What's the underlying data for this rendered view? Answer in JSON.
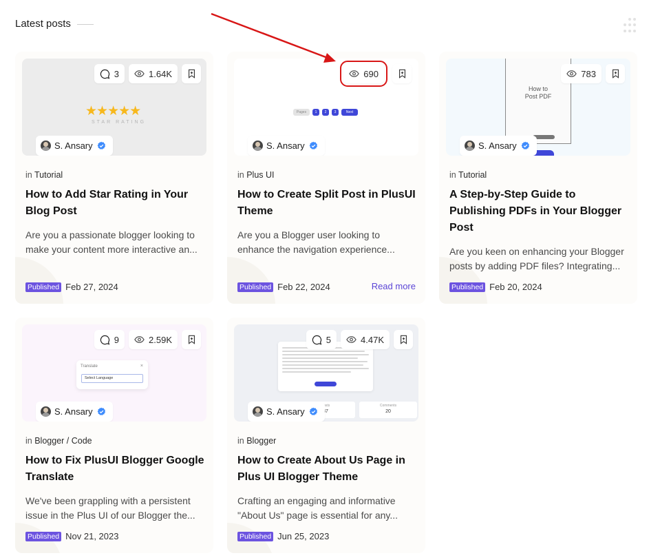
{
  "section": {
    "title": "Latest posts"
  },
  "posts": [
    {
      "comments": "3",
      "views": "1.64K",
      "author": "S. Ansary",
      "category_prefix": "in",
      "category": "Tutorial",
      "title": "How to Add Star Rating in Your Blog Post",
      "excerpt": "Are you a passionate blogger looking to make your content more interactive an...",
      "status": "Published",
      "date": "Feb 27, 2024",
      "thumb": {
        "stars": "★★★★★",
        "caption": "STAR RATING"
      }
    },
    {
      "views": "690",
      "author": "S. Ansary",
      "category_prefix": "in",
      "category": "Plus UI",
      "title": "How to Create Split Post in PlusUI Theme",
      "excerpt": "Are you a Blogger user looking to enhance the navigation experience...",
      "status": "Published",
      "date": "Feb 22, 2024",
      "read_more": "Read more",
      "thumb": {
        "prev": "Pages",
        "p1": "1",
        "p2": "2",
        "p3": "3",
        "next": "Next"
      }
    },
    {
      "views": "783",
      "author": "S. Ansary",
      "category_prefix": "in",
      "category": "Tutorial",
      "title": "A Step-by-Step Guide to Publishing PDFs in Your Blogger Post",
      "excerpt": "Are you keen on enhancing your Blogger posts by adding PDF files? Integrating...",
      "status": "Published",
      "date": "Feb 20, 2024",
      "thumb": {
        "line1": "How to",
        "line2": "Post PDF"
      }
    },
    {
      "comments": "9",
      "views": "2.59K",
      "author": "S. Ansary",
      "category_prefix": "in",
      "category": "Blogger / Code",
      "title": "How to Fix PlusUI Blogger Google Translate",
      "excerpt": "We've been grappling with a persistent issue in the Plus UI of our Blogger the...",
      "status": "Published",
      "date": "Nov 21, 2023",
      "thumb": {
        "label": "Translate",
        "close": "×",
        "select": "Select Language"
      }
    },
    {
      "comments": "5",
      "views": "4.47K",
      "author": "S. Ansary",
      "category_prefix": "in",
      "category": "Blogger",
      "title": "How to Create About Us Page in Plus UI Blogger Theme",
      "excerpt": "Crafting an engaging and informative \"About Us\" page is essential for any...",
      "status": "Published",
      "date": "Jun 25, 2023",
      "thumb": {
        "stat1_label": "Posts",
        "stat1_value": "37",
        "stat2_label": "Comments",
        "stat2_value": "20"
      }
    }
  ],
  "colors": {
    "accent": "#6c53e0",
    "link": "#5b45d6",
    "highlight": "#d81616",
    "verified": "#3d8bfd"
  },
  "icons": {
    "comment": "comment-icon",
    "views": "eye-icon",
    "bookmark": "bookmark-icon",
    "verified": "verified-icon",
    "grid": "grid-dots-icon"
  }
}
